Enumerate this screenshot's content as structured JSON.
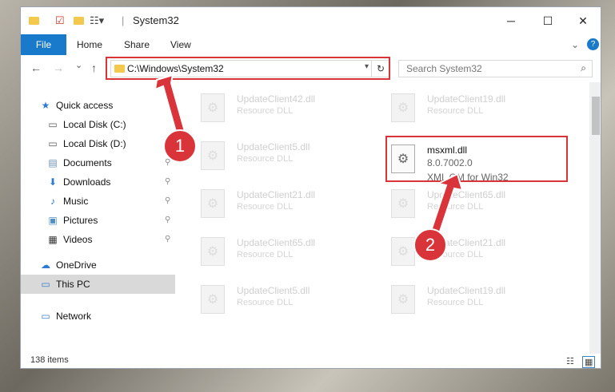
{
  "window": {
    "title": "System32",
    "quick_access_icons": [
      "folder-icon",
      "properties-check-icon",
      "new-folder-icon",
      "customize-icon"
    ],
    "controls": {
      "minimize": "─",
      "maximize": "☐",
      "close": "✕"
    }
  },
  "ribbon": {
    "tabs": [
      {
        "label": "File"
      },
      {
        "label": "Home"
      },
      {
        "label": "Share"
      },
      {
        "label": "View"
      }
    ],
    "expand_icon": "chevron-down-icon",
    "help_icon": "?"
  },
  "navigation": {
    "back_icon": "←",
    "forward_icon": "→",
    "recent_icon": "⌄",
    "up_icon": "↑",
    "address": "C:\\Windows\\System32",
    "refresh_icon": "↻",
    "search_placeholder": "Search System32"
  },
  "nav_pane": {
    "items": [
      {
        "label": "Quick access",
        "icon": "star-icon",
        "glyph": "★",
        "color": "#2d7bd1",
        "pinned": false
      },
      {
        "label": "Local Disk (C:)",
        "icon": "drive-icon",
        "glyph": "▭",
        "color": "#555555",
        "pinned": false
      },
      {
        "label": "Local Disk (D:)",
        "icon": "drive-icon",
        "glyph": "▭",
        "color": "#555555",
        "pinned": false
      },
      {
        "label": "Documents",
        "icon": "documents-icon",
        "glyph": "▤",
        "color": "#6b8fb5",
        "pinned": true
      },
      {
        "label": "Downloads",
        "icon": "download-arrow-icon",
        "glyph": "⬇",
        "color": "#2d7bd1",
        "pinned": true
      },
      {
        "label": "Music",
        "icon": "music-note-icon",
        "glyph": "♪",
        "color": "#2d7bd1",
        "pinned": true
      },
      {
        "label": "Pictures",
        "icon": "pictures-icon",
        "glyph": "▣",
        "color": "#4f8fc7",
        "pinned": true
      },
      {
        "label": "Videos",
        "icon": "film-icon",
        "glyph": "▦",
        "color": "#333333",
        "pinned": true
      },
      {
        "label": "OneDrive",
        "icon": "cloud-icon",
        "glyph": "☁",
        "color": "#2d7bd1",
        "pinned": false
      },
      {
        "label": "This PC",
        "icon": "computer-icon",
        "glyph": "▭",
        "color": "#3c82c4",
        "pinned": false,
        "selected": true
      },
      {
        "label": "Network",
        "icon": "network-icon",
        "glyph": "▭",
        "color": "#3c82c4",
        "pinned": false
      }
    ],
    "pin_glyph": "📌"
  },
  "files": [
    {
      "name": "UpdateClient42.dll",
      "type": "Resource DLL"
    },
    {
      "name": "UpdateClient19.dll",
      "type": "Resource DLL"
    },
    {
      "name": "UpdateClient5.dll",
      "type": "Resource DLL"
    },
    {
      "name": "msxml.dll",
      "version": "8.0.7002.0",
      "description": "XML OM for Win32",
      "highlighted": true
    },
    {
      "name": "UpdateClient21.dll",
      "type": "Resource DLL"
    },
    {
      "name": "UpdateClient65.dll",
      "type": "Resource DLL"
    },
    {
      "name": "UpdateClient65.dll",
      "type": "Resource DLL"
    },
    {
      "name": "UpdateClient21.dll",
      "type": "Resource DLL"
    },
    {
      "name": "UpdateClient5.dll",
      "type": "Resource DLL"
    },
    {
      "name": "UpdateClient19.dll",
      "type": "Resource DLL"
    }
  ],
  "status": {
    "item_count": "138 items"
  },
  "annotations": {
    "step1": "1",
    "step2": "2",
    "accent_color": "#d9343a"
  },
  "colors": {
    "file_tab": "#1979ca",
    "selection": "#d9d9d9"
  }
}
